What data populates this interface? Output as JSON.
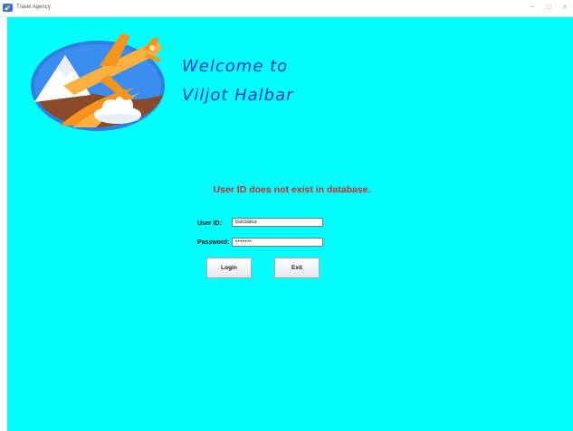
{
  "window": {
    "title": "Travel Agency",
    "minimize_glyph": "–",
    "maximize_glyph": "□",
    "close_glyph": "×"
  },
  "colors": {
    "background": "#00ffff",
    "welcome_text": "#1a3ccc",
    "error_text": "#cc2a2a"
  },
  "logo": {
    "icon": "airplane-travel-logo"
  },
  "welcome": {
    "line1": "Welcome to",
    "line2": "Viljot Halbar"
  },
  "error_message": "User ID does not exist in database.",
  "form": {
    "user_id_label": "User ID:",
    "user_id_value": "Bardakia",
    "password_label": "Password:",
    "password_value": "•••••••",
    "login_label": "Login",
    "exit_label": "Exit"
  }
}
